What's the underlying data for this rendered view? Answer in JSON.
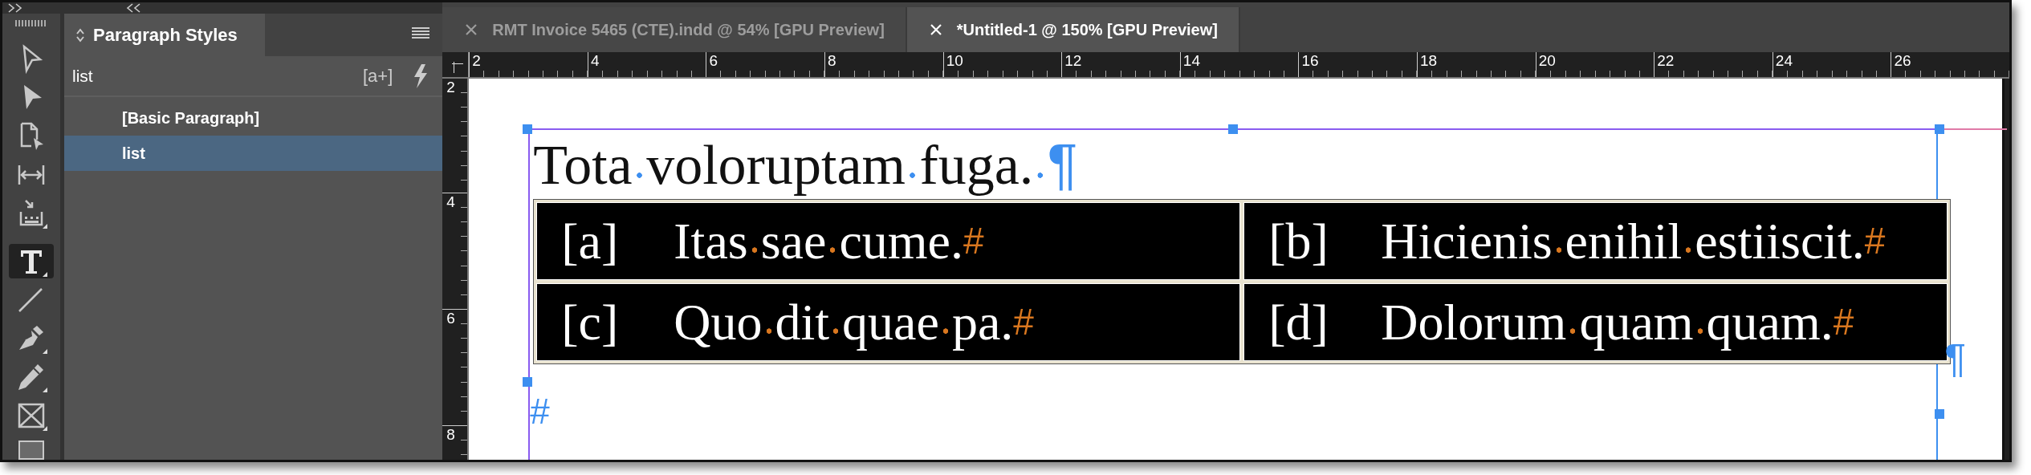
{
  "tools": [
    {
      "kind": "selection",
      "selected": false
    },
    {
      "kind": "direct-selection",
      "selected": false
    },
    {
      "kind": "page",
      "selected": false
    },
    {
      "kind": "gap",
      "selected": false
    },
    {
      "kind": "content-collector",
      "selected": false
    },
    {
      "kind": "type",
      "selected": true
    },
    {
      "kind": "line",
      "selected": false
    },
    {
      "kind": "pen",
      "selected": false
    },
    {
      "kind": "pencil",
      "selected": false
    },
    {
      "kind": "rectangle-frame",
      "selected": false
    },
    {
      "kind": "rectangle",
      "selected": false
    }
  ],
  "panel": {
    "title": "Paragraph Styles",
    "current_style": "list",
    "new_style_label": "[a+]",
    "styles": [
      {
        "label": "[Basic Paragraph]",
        "selected": false
      },
      {
        "label": "list",
        "selected": true
      }
    ]
  },
  "tabs": [
    {
      "label": "RMT Invoice 5465 (CTE).indd @ 54% [GPU Preview]",
      "selected": false
    },
    {
      "label": "*Untitled-1 @ 150% [GPU Preview]",
      "selected": true
    }
  ],
  "rulers": {
    "horizontal": [
      "2",
      "4",
      "6",
      "8",
      "10",
      "12",
      "14",
      "16",
      "18",
      "20",
      "22",
      "24",
      "26"
    ],
    "vertical": [
      "2",
      "4",
      "6",
      "8"
    ]
  },
  "document": {
    "heading": {
      "text": "Tota voloruptam fuga.",
      "end_mark": "¶"
    },
    "table": {
      "rows": [
        [
          {
            "label": "[a]",
            "text": "Itas sae cume.",
            "end_mark": "#"
          },
          {
            "label": "[b]",
            "text": "Hicienis enihil estiiscit.",
            "end_mark": "#"
          }
        ],
        [
          {
            "label": "[c]",
            "text": "Quo dit quae pa.",
            "end_mark": "#"
          },
          {
            "label": "[d]",
            "text": "Dolorum quam quam.",
            "end_mark": "#"
          }
        ]
      ]
    },
    "table_end_mark": "¶",
    "story_end_mark": "#"
  }
}
